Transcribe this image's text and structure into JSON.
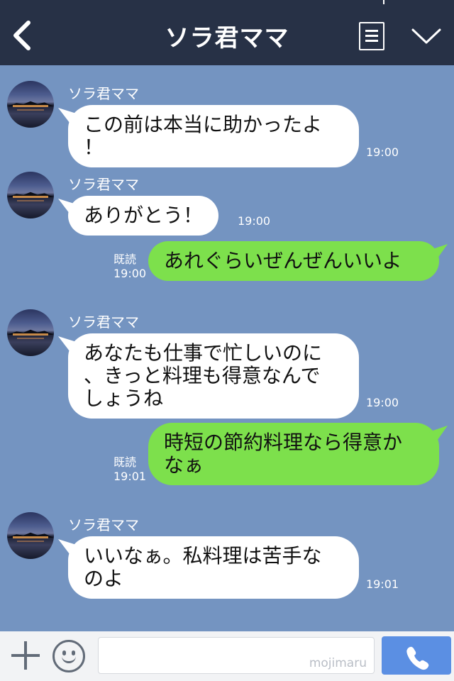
{
  "header": {
    "title": "ソラ君ママ"
  },
  "messages": [
    {
      "sender": "ソラ君ママ",
      "text": "この前は本当に助かったよ\n！",
      "time": "19:00"
    },
    {
      "sender": "ソラ君ママ",
      "text": "ありがとう！",
      "time": "19:00"
    },
    {
      "text": "あれぐらいぜんぜんいいよ",
      "read": "既読",
      "time": "19:00"
    },
    {
      "sender": "ソラ君ママ",
      "text": "あなたも仕事で忙しいのに\n、きっと料理も得意なんで\nしょうね",
      "time": "19:00"
    },
    {
      "text": "時短の節約料理なら得意か\nなぁ",
      "read": "既読",
      "time": "19:01"
    },
    {
      "sender": "ソラ君ママ",
      "text": "いいなぁ。私料理は苦手な\nのよ",
      "time": "19:01"
    }
  ],
  "footer": {
    "watermark": "mojimaru"
  },
  "colors": {
    "header_bg": "#273146",
    "chat_bg": "#7494c1",
    "outgoing_bubble": "#7de04c",
    "incoming_bubble": "#ffffff",
    "call_button": "#5b8fe3"
  },
  "icons": {
    "back": "chevron-left-icon",
    "menu": "note-icon",
    "dropdown": "chevron-down-icon",
    "plus": "plus-icon",
    "emoji": "smile-icon",
    "call": "phone-icon"
  }
}
